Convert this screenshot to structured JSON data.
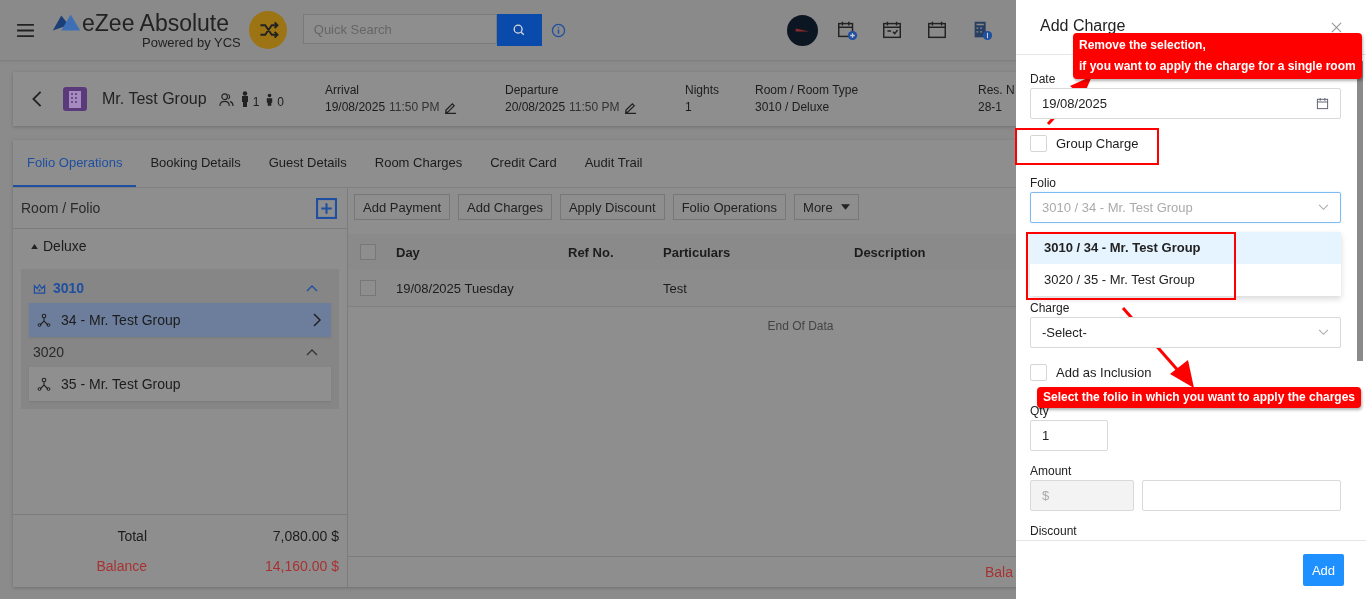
{
  "app": {
    "brand": "eZee Absolute",
    "tagline": "Powered by YCS"
  },
  "search": {
    "placeholder": "Quick Search"
  },
  "reservation": {
    "name": "Mr. Test Group",
    "adults": "1",
    "children": "0",
    "fields": [
      {
        "kind": "datetime",
        "label": "Arrival",
        "date": "19/08/2025",
        "time": "11:50 PM"
      },
      {
        "kind": "datetime",
        "label": "Departure",
        "date": "20/08/2025",
        "time": "11:50 PM"
      },
      {
        "kind": "text",
        "label": "Nights",
        "value": "1"
      },
      {
        "kind": "text",
        "label": "Room / Room Type",
        "value": "3010 / Deluxe"
      },
      {
        "kind": "text",
        "label": "Res. N",
        "value": "28-1"
      }
    ]
  },
  "tabs": [
    {
      "label": "Folio Operations",
      "selected": true
    },
    {
      "label": "Booking Details",
      "selected": false
    },
    {
      "label": "Guest Details",
      "selected": false
    },
    {
      "label": "Room Charges",
      "selected": false
    },
    {
      "label": "Credit Card",
      "selected": false
    },
    {
      "label": "Audit Trail",
      "selected": false
    }
  ],
  "folio_panel": {
    "title": "Room / Folio",
    "room_type": "Deluxe",
    "rooms": [
      {
        "number": "3010",
        "master": true,
        "folios": [
          {
            "label": "34 - Mr. Test Group",
            "selected": true
          }
        ]
      },
      {
        "number": "3020",
        "master": false,
        "folios": [
          {
            "label": "35 - Mr. Test Group",
            "selected": false
          }
        ]
      }
    ],
    "totals": [
      {
        "kind": "total",
        "label": "Total",
        "value": "7,080.00 $"
      },
      {
        "kind": "balance",
        "label": "Balance",
        "value": "14,160.00 $"
      }
    ]
  },
  "toolbar": [
    {
      "label": "Add Payment",
      "dropdown": false
    },
    {
      "label": "Add Charges",
      "dropdown": false
    },
    {
      "label": "Apply Discount",
      "dropdown": false
    },
    {
      "label": "Folio Operations",
      "dropdown": false
    },
    {
      "label": "More",
      "dropdown": true
    }
  ],
  "table": {
    "columns": [
      "Day",
      "Ref No.",
      "Particulars",
      "Description"
    ],
    "all_checked": false,
    "rows": [
      {
        "checked": false,
        "day": "19/08/2025 Tuesday",
        "particulars": "Test"
      }
    ],
    "end_text": "End Of Data",
    "footer_label": "Bala"
  },
  "drawer": {
    "title": "Add Charge",
    "date": {
      "label": "Date",
      "value": "19/08/2025"
    },
    "group_charge": {
      "label": "Group Charge",
      "checked": false
    },
    "folio": {
      "label": "Folio",
      "value": "3010 / 34 - Mr. Test Group",
      "expanded": true,
      "options": [
        {
          "label": "3010 / 34 - Mr. Test Group",
          "selected": true
        },
        {
          "label": "3020 / 35 - Mr. Test Group",
          "selected": false
        }
      ]
    },
    "charge": {
      "label": "Charge",
      "value": "-Select-"
    },
    "inclusion": {
      "label": "Add as Inclusion",
      "checked": false
    },
    "qty": {
      "label": "Qty",
      "value": "1"
    },
    "amount": {
      "label": "Amount",
      "currency": "$"
    },
    "discount": {
      "label": "Discount"
    },
    "button": "Add"
  },
  "annotations": [
    {
      "lines": [
        "Remove the selection,",
        "if you want to apply the charge for a single room"
      ]
    },
    {
      "lines": [
        "Select the folio in which you want to apply the charges"
      ]
    }
  ]
}
